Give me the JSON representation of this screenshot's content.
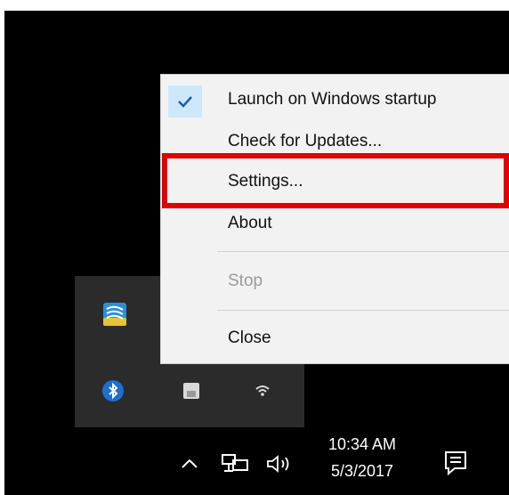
{
  "menu": {
    "items": [
      {
        "label": "Launch on Windows startup",
        "checked": true,
        "disabled": false
      },
      {
        "label": "Check for Updates...",
        "checked": false,
        "disabled": false
      },
      {
        "label": "Settings...",
        "checked": false,
        "disabled": false,
        "highlighted": true
      },
      {
        "label": "About",
        "checked": false,
        "disabled": false
      },
      {
        "label": "Stop",
        "checked": false,
        "disabled": true
      },
      {
        "label": "Close",
        "checked": false,
        "disabled": false
      }
    ]
  },
  "tray_icons": [
    "app-tray-icon",
    "bluetooth-icon",
    "usb-drive-icon",
    "wifi-icon"
  ],
  "taskbar": {
    "time": "10:34 AM",
    "date": "5/3/2017",
    "icons": [
      "chevron-up-icon",
      "network-icon",
      "volume-icon",
      "action-center-icon"
    ]
  },
  "colors": {
    "highlight_border": "#e00000",
    "menu_background": "#f2f2f2",
    "check_background": "#cde8fb",
    "taskbar": "#000000",
    "tray_flyout": "#2b2b2b"
  }
}
